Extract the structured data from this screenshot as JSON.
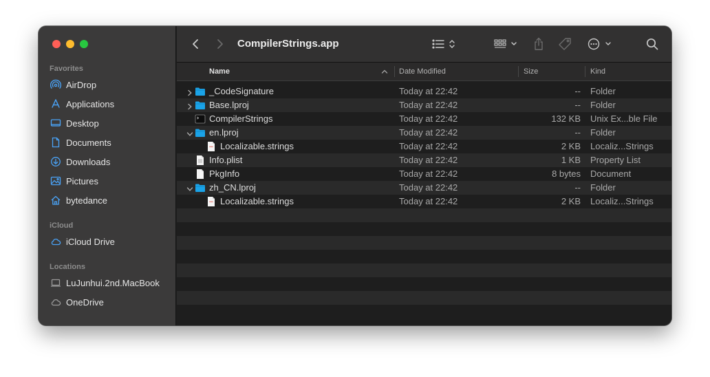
{
  "window": {
    "title": "CompilerStrings.app"
  },
  "sidebar": {
    "sections": [
      {
        "title": "Favorites",
        "items": [
          {
            "label": "AirDrop",
            "icon": "airdrop-icon"
          },
          {
            "label": "Applications",
            "icon": "applications-icon"
          },
          {
            "label": "Desktop",
            "icon": "desktop-icon"
          },
          {
            "label": "Documents",
            "icon": "document-icon"
          },
          {
            "label": "Downloads",
            "icon": "download-icon"
          },
          {
            "label": "Pictures",
            "icon": "pictures-icon"
          },
          {
            "label": "bytedance",
            "icon": "home-icon"
          }
        ]
      },
      {
        "title": "iCloud",
        "items": [
          {
            "label": "iCloud Drive",
            "icon": "cloud-icon"
          }
        ]
      },
      {
        "title": "Locations",
        "items": [
          {
            "label": "LuJunhui.2nd.MacBook",
            "icon": "laptop-icon"
          },
          {
            "label": "OneDrive",
            "icon": "cloud-icon"
          }
        ]
      }
    ]
  },
  "toolbar": {
    "back_icon": "chevron-left-icon",
    "forward_icon": "chevron-right-icon",
    "view_icon": "list-view-icon",
    "group_icon": "group-grid-icon",
    "share_icon": "share-icon",
    "tag_icon": "tag-icon",
    "more_icon": "ellipsis-circle-icon",
    "search_icon": "search-icon"
  },
  "columns": {
    "name": "Name",
    "date": "Date Modified",
    "size": "Size",
    "kind": "Kind"
  },
  "files": [
    {
      "name": "_CodeSignature",
      "date": "Today at 22:42",
      "size": "--",
      "kind": "Folder",
      "type": "folder",
      "indent": 0,
      "disclosure": "collapsed"
    },
    {
      "name": "Base.lproj",
      "date": "Today at 22:42",
      "size": "--",
      "kind": "Folder",
      "type": "folder",
      "indent": 0,
      "disclosure": "collapsed"
    },
    {
      "name": "CompilerStrings",
      "date": "Today at 22:42",
      "size": "132 KB",
      "kind": "Unix Ex...ble File",
      "type": "exec",
      "indent": 0,
      "disclosure": "none"
    },
    {
      "name": "en.lproj",
      "date": "Today at 22:42",
      "size": "--",
      "kind": "Folder",
      "type": "folder",
      "indent": 0,
      "disclosure": "expanded"
    },
    {
      "name": "Localizable.strings",
      "date": "Today at 22:42",
      "size": "2 KB",
      "kind": "Localiz...Strings",
      "type": "strings",
      "indent": 1,
      "disclosure": "none"
    },
    {
      "name": "Info.plist",
      "date": "Today at 22:42",
      "size": "1 KB",
      "kind": "Property List",
      "type": "plist",
      "indent": 0,
      "disclosure": "none"
    },
    {
      "name": "PkgInfo",
      "date": "Today at 22:42",
      "size": "8 bytes",
      "kind": "Document",
      "type": "doc",
      "indent": 0,
      "disclosure": "none"
    },
    {
      "name": "zh_CN.lproj",
      "date": "Today at 22:42",
      "size": "--",
      "kind": "Folder",
      "type": "folder",
      "indent": 0,
      "disclosure": "expanded"
    },
    {
      "name": "Localizable.strings",
      "date": "Today at 22:42",
      "size": "2 KB",
      "kind": "Localiz...Strings",
      "type": "strings",
      "indent": 1,
      "disclosure": "none"
    }
  ],
  "colors": {
    "folder": "#1aa3e8",
    "accent": "#3f96f5",
    "strings_icon": "#e04a3f"
  }
}
